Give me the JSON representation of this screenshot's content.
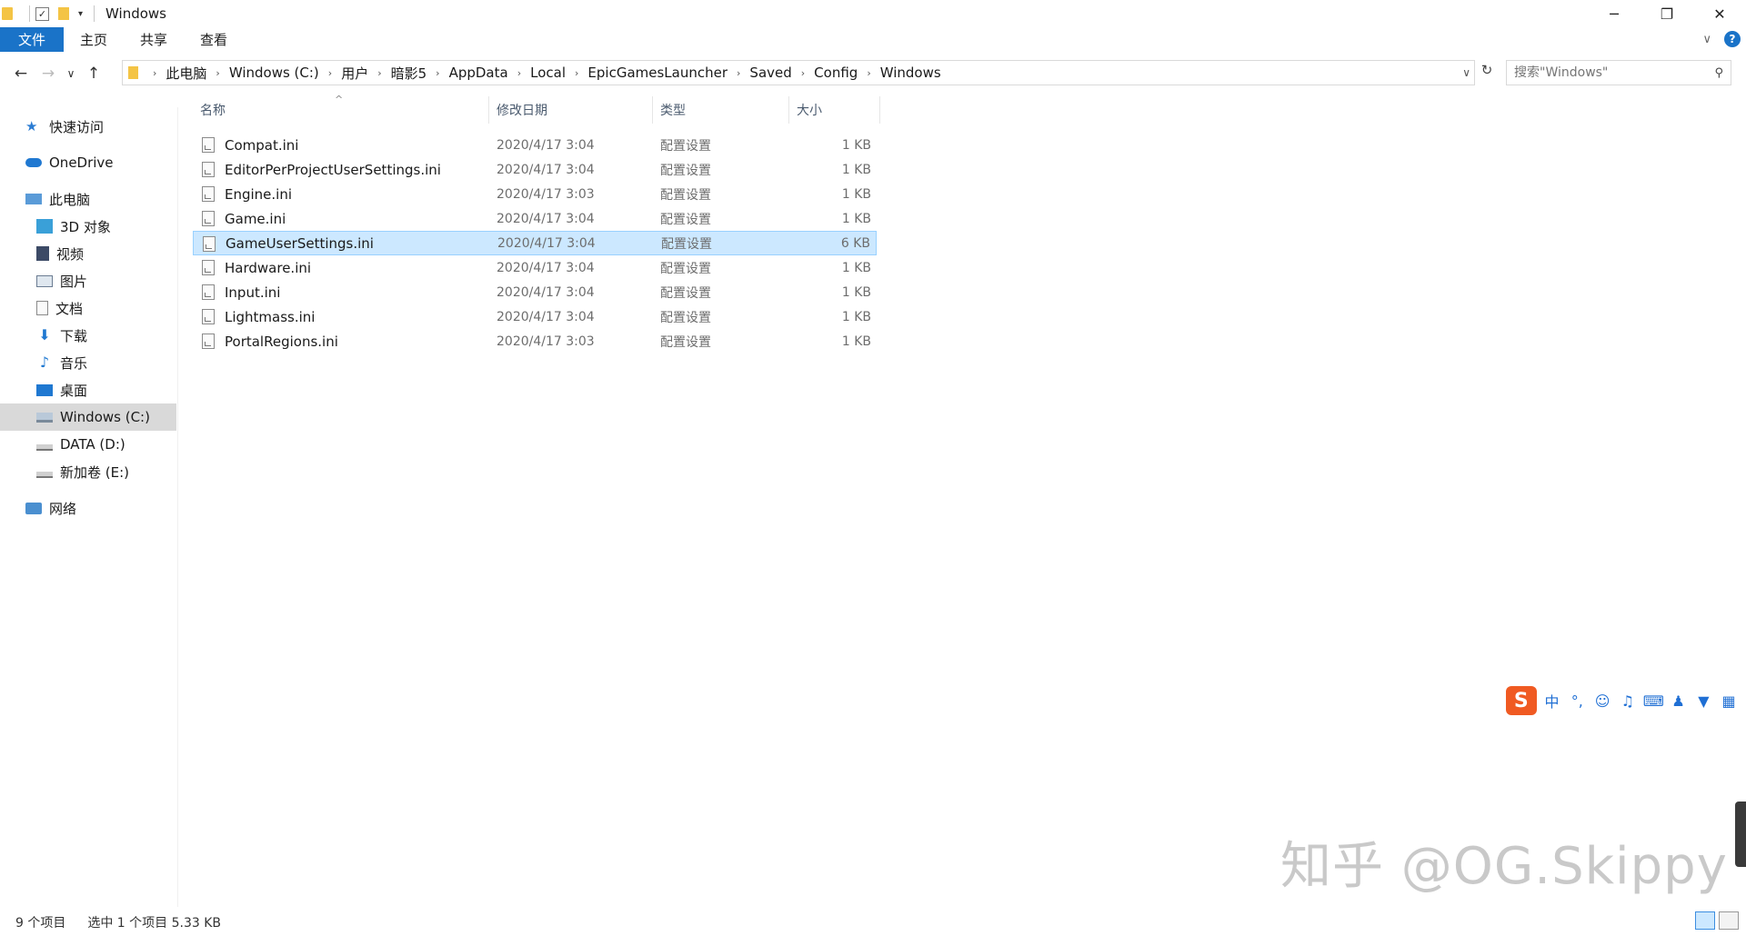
{
  "window": {
    "title": "Windows",
    "controls": {
      "minimize": "─",
      "maximize": "❐",
      "close": "✕"
    }
  },
  "ribbon": {
    "tabs": [
      "文件",
      "主页",
      "共享",
      "查看"
    ],
    "help": "?"
  },
  "address": {
    "crumbs": [
      "此电脑",
      "Windows (C:)",
      "用户",
      "暗影5",
      "AppData",
      "Local",
      "EpicGamesLauncher",
      "Saved",
      "Config",
      "Windows"
    ],
    "search_placeholder": "搜索\"Windows\""
  },
  "sidebar": {
    "items": [
      {
        "label": "快速访问",
        "icon": "star-icon"
      },
      {
        "label": "OneDrive",
        "icon": "cloud-icon"
      },
      {
        "label": "此电脑",
        "icon": "computer-icon"
      },
      {
        "label": "3D 对象",
        "icon": "cube-icon"
      },
      {
        "label": "视频",
        "icon": "video-icon"
      },
      {
        "label": "图片",
        "icon": "picture-icon"
      },
      {
        "label": "文档",
        "icon": "document-icon"
      },
      {
        "label": "下载",
        "icon": "download-icon"
      },
      {
        "label": "音乐",
        "icon": "music-icon"
      },
      {
        "label": "桌面",
        "icon": "desktop-icon"
      },
      {
        "label": "Windows (C:)",
        "icon": "drive-c-icon"
      },
      {
        "label": "DATA (D:)",
        "icon": "drive-icon"
      },
      {
        "label": "新加卷 (E:)",
        "icon": "drive-icon"
      },
      {
        "label": "网络",
        "icon": "network-icon"
      }
    ],
    "selected_index": 10
  },
  "columns": {
    "name": "名称",
    "date": "修改日期",
    "type": "类型",
    "size": "大小"
  },
  "files": [
    {
      "name": "Compat.ini",
      "date": "2020/4/17 3:04",
      "type": "配置设置",
      "size": "1 KB"
    },
    {
      "name": "EditorPerProjectUserSettings.ini",
      "date": "2020/4/17 3:04",
      "type": "配置设置",
      "size": "1 KB"
    },
    {
      "name": "Engine.ini",
      "date": "2020/4/17 3:03",
      "type": "配置设置",
      "size": "1 KB"
    },
    {
      "name": "Game.ini",
      "date": "2020/4/17 3:04",
      "type": "配置设置",
      "size": "1 KB"
    },
    {
      "name": "GameUserSettings.ini",
      "date": "2020/4/17 3:04",
      "type": "配置设置",
      "size": "6 KB"
    },
    {
      "name": "Hardware.ini",
      "date": "2020/4/17 3:04",
      "type": "配置设置",
      "size": "1 KB"
    },
    {
      "name": "Input.ini",
      "date": "2020/4/17 3:04",
      "type": "配置设置",
      "size": "1 KB"
    },
    {
      "name": "Lightmass.ini",
      "date": "2020/4/17 3:04",
      "type": "配置设置",
      "size": "1 KB"
    },
    {
      "name": "PortalRegions.ini",
      "date": "2020/4/17 3:03",
      "type": "配置设置",
      "size": "1 KB"
    }
  ],
  "selected_file_index": 4,
  "status": {
    "count": "9 个项目",
    "selection": "选中 1 个项目  5.33 KB"
  },
  "ime": {
    "logo": "S",
    "mode": "中",
    "punct": "°,"
  },
  "watermark": "知乎 @OG.Skippy",
  "colors": {
    "accent": "#1a73c8",
    "selection": "#cce8ff",
    "sidebar_selected": "#d9d9d9"
  }
}
